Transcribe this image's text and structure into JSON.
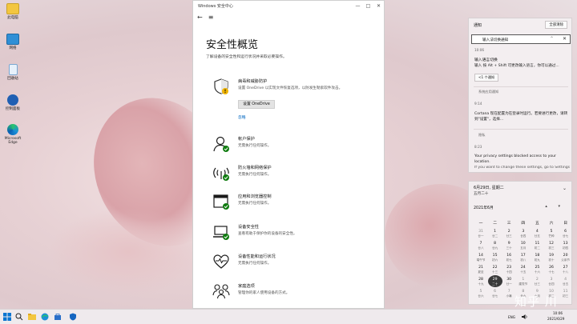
{
  "desktop": {
    "icons": [
      {
        "label": "此电脑"
      },
      {
        "label": "网络"
      },
      {
        "label": "回收站"
      },
      {
        "label": "控制面板"
      },
      {
        "label": "Microsoft Edge"
      }
    ]
  },
  "window": {
    "title": "Windows 安全中心",
    "minimize": "—",
    "maximize": "□",
    "close": "✕",
    "back": "←",
    "menu": "≡"
  },
  "page": {
    "title": "安全性概览",
    "subtitle": "了解设备的安全性和运行状况并采取必要操作。"
  },
  "sections": [
    {
      "title": "病毒和威胁防护",
      "desc": "设置 OneDrive 以实现文件恢复选项，以防发生勒索软件攻击。",
      "action": "设置 OneDrive",
      "link": "忽略"
    },
    {
      "title": "帐户保护",
      "desc": "无需执行任何操作。"
    },
    {
      "title": "防火墙和网络保护",
      "desc": "无需执行任何操作。"
    },
    {
      "title": "应用和浏览器控制",
      "desc": "无需执行任何操作。"
    },
    {
      "title": "设备安全性",
      "desc": "查看有助于保护你的设备的安全性。"
    },
    {
      "title": "设备性能和运行状况",
      "desc": "无需执行任何操作。"
    },
    {
      "title": "家庭选项",
      "desc": "管理你的家人使用设备的方式。"
    }
  ],
  "notifications": {
    "title": "通知",
    "clear_all": "全部清除",
    "focus_bar": "输入法切换通知",
    "items": [
      {
        "time": "10:06",
        "title": "输入语言切换",
        "body": "输入 按 Alt + Shift 可更改输入语言，你可以通过...",
        "action": "<1 个通知"
      },
      {
        "time": "9:14",
        "section": "系统应用通知",
        "body": "Cortana 现在配置为在登录时运行。若要进行更改，请转到\"设置\"，选择..."
      },
      {
        "time": "8:23",
        "section": "隐私",
        "title": "Your privacy settings blocked access to your location.",
        "body": "If you want to change these settings, go to Settings"
      }
    ]
  },
  "calendar": {
    "date_text": "6月29日, 星期二",
    "lunar_text": "五月二十",
    "collapse": "⌄",
    "month_label": "2021年6月",
    "nav": "▴ ▾",
    "weekdays": [
      "一",
      "二",
      "三",
      "四",
      "五",
      "六",
      "日"
    ],
    "days": [
      {
        "n": "31",
        "l": "廿一",
        "dim": true
      },
      {
        "n": "1",
        "l": "廿二"
      },
      {
        "n": "2",
        "l": "廿三"
      },
      {
        "n": "3",
        "l": "廿四"
      },
      {
        "n": "4",
        "l": "廿五"
      },
      {
        "n": "5",
        "l": "芒种"
      },
      {
        "n": "6",
        "l": "廿七"
      },
      {
        "n": "7",
        "l": "廿八"
      },
      {
        "n": "8",
        "l": "廿九"
      },
      {
        "n": "9",
        "l": "三十"
      },
      {
        "n": "10",
        "l": "五月"
      },
      {
        "n": "11",
        "l": "初二"
      },
      {
        "n": "12",
        "l": "初三"
      },
      {
        "n": "13",
        "l": "初四"
      },
      {
        "n": "14",
        "l": "端午节"
      },
      {
        "n": "15",
        "l": "初六"
      },
      {
        "n": "16",
        "l": "初七"
      },
      {
        "n": "17",
        "l": "初八"
      },
      {
        "n": "18",
        "l": "初九"
      },
      {
        "n": "19",
        "l": "初十"
      },
      {
        "n": "20",
        "l": "父亲节"
      },
      {
        "n": "21",
        "l": "夏至"
      },
      {
        "n": "22",
        "l": "十三"
      },
      {
        "n": "23",
        "l": "十四"
      },
      {
        "n": "24",
        "l": "十五"
      },
      {
        "n": "25",
        "l": "十六"
      },
      {
        "n": "26",
        "l": "十七"
      },
      {
        "n": "27",
        "l": "十八"
      },
      {
        "n": "28",
        "l": "十九"
      },
      {
        "n": "29",
        "l": "二十",
        "today": true
      },
      {
        "n": "30",
        "l": "廿一"
      },
      {
        "n": "1",
        "l": "建党节",
        "dim": true
      },
      {
        "n": "2",
        "l": "廿三",
        "dim": true
      },
      {
        "n": "3",
        "l": "廿四",
        "dim": true
      },
      {
        "n": "4",
        "l": "廿五",
        "dim": true
      },
      {
        "n": "5",
        "l": "廿六",
        "dim": true
      },
      {
        "n": "6",
        "l": "廿七",
        "dim": true
      },
      {
        "n": "7",
        "l": "小暑",
        "dim": true
      },
      {
        "n": "8",
        "l": "廿九",
        "dim": true
      },
      {
        "n": "9",
        "l": "六月",
        "dim": true
      },
      {
        "n": "10",
        "l": "初二",
        "dim": true
      },
      {
        "n": "11",
        "l": "初三",
        "dim": true
      }
    ]
  },
  "taskbar": {
    "lang": "ENG",
    "time": "10:06",
    "date": "2021/6/29"
  },
  "watermark": "知乎 川"
}
